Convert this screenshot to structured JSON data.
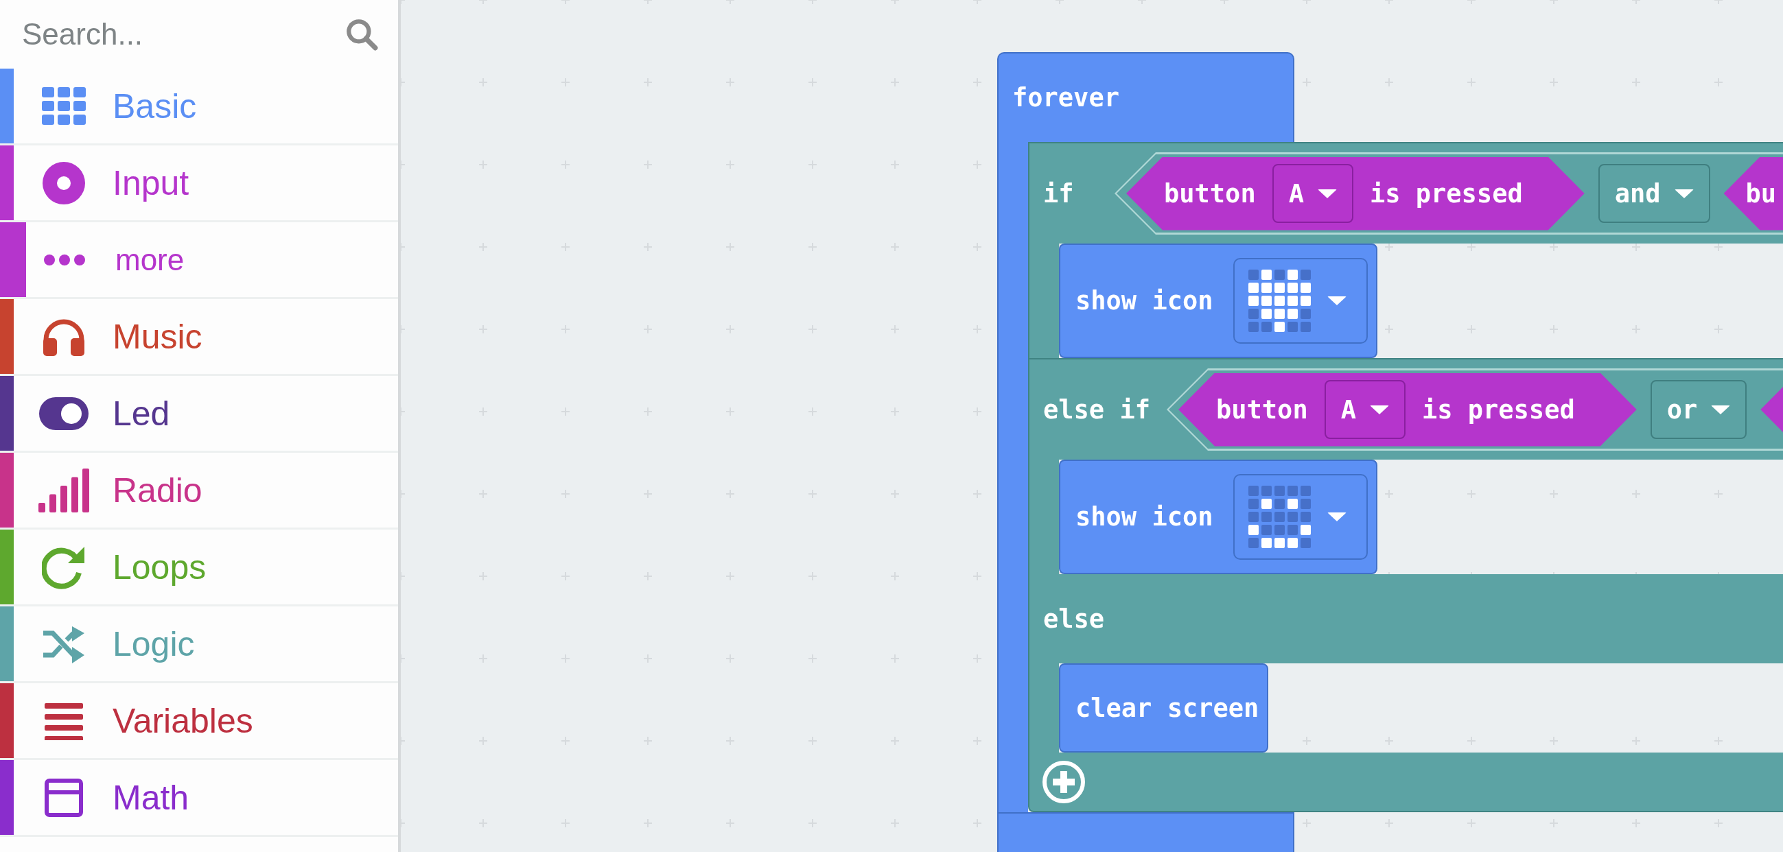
{
  "search": {
    "placeholder": "Search..."
  },
  "categories": [
    {
      "label": "Basic",
      "color": "#5b8ff4"
    },
    {
      "label": "Input",
      "color": "#b535cc",
      "children": [
        {
          "label": "more",
          "color": "#b535cc"
        }
      ]
    },
    {
      "label": "Music",
      "color": "#c7432f"
    },
    {
      "label": "Led",
      "color": "#55368f"
    },
    {
      "label": "Radio",
      "color": "#c8338a"
    },
    {
      "label": "Loops",
      "color": "#5ea82e"
    },
    {
      "label": "Logic",
      "color": "#5ea4a8"
    },
    {
      "label": "Variables",
      "color": "#bd3040"
    },
    {
      "label": "Math",
      "color": "#8a2dcc"
    }
  ],
  "script": {
    "hat": "forever",
    "branches": [
      {
        "keyword": "if",
        "condition": {
          "text_1": "button",
          "value": "A",
          "text_2": "is pressed",
          "operator": "and",
          "right_block": true,
          "right_text": "bu"
        },
        "statement": {
          "label": "show icon",
          "leds": [
            [
              false,
              true,
              false,
              true,
              false
            ],
            [
              true,
              true,
              true,
              true,
              true
            ],
            [
              true,
              true,
              true,
              true,
              true
            ],
            [
              false,
              true,
              true,
              true,
              false
            ],
            [
              false,
              false,
              true,
              false,
              false
            ]
          ]
        }
      },
      {
        "keyword": "else if",
        "condition": {
          "text_1": "button",
          "value": "A",
          "text_2": "is pressed",
          "operator": "or",
          "right_block": true
        },
        "statement": {
          "label": "show icon",
          "leds": [
            [
              false,
              false,
              false,
              false,
              false
            ],
            [
              false,
              true,
              false,
              true,
              false
            ],
            [
              false,
              false,
              false,
              false,
              false
            ],
            [
              true,
              false,
              false,
              false,
              true
            ],
            [
              false,
              true,
              true,
              true,
              false
            ]
          ]
        }
      }
    ],
    "else": {
      "keyword": "else",
      "statement": {
        "label": "clear screen"
      }
    },
    "add_button": true
  }
}
